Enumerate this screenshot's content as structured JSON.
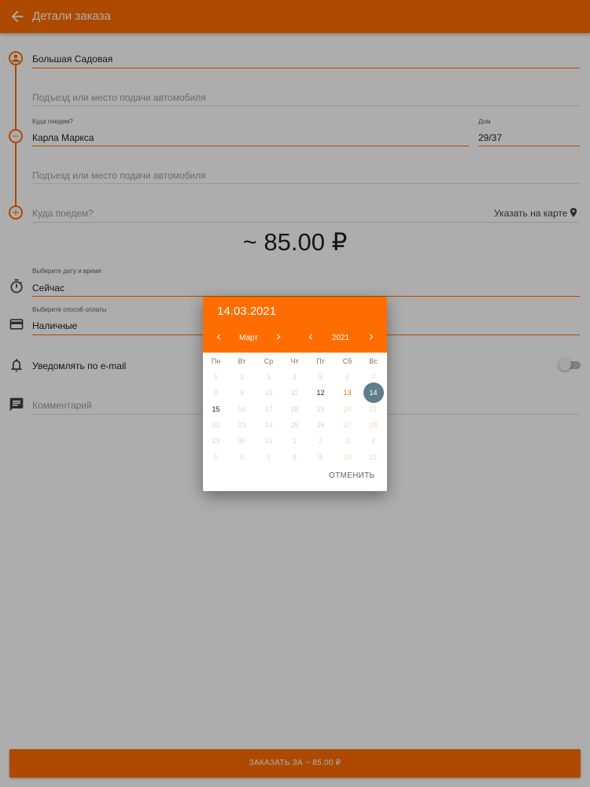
{
  "appbar": {
    "title": "Детали заказа",
    "back_icon": "arrow-back-icon"
  },
  "route": {
    "from_value": "Большая Садовая",
    "entrance_hint_1": "Подъезд или место подачи автомобиля",
    "to_label": "Куда поедем?",
    "to_value": "Карла Маркса",
    "house_label": "Дом",
    "house_value": "29/37",
    "entrance_hint_2": "Подъезд или место подачи автомобиля",
    "add_hint": "Куда поедем?",
    "map_link": "Указать на карте"
  },
  "price": "~ 85.00 ₽",
  "datetime": {
    "label": "Выберите дату и время",
    "value": "Сейчас"
  },
  "payment": {
    "label": "Выберите способ оплаты",
    "value": "Наличные"
  },
  "notify": {
    "label": "Уведомлять по e-mail",
    "enabled": false
  },
  "comment": {
    "hint": "Комментарий"
  },
  "order_button": "ЗАКАЗАТЬ ЗА ~ 85.00 ₽",
  "picker": {
    "selected_date": "14.03.2021",
    "month": "Март",
    "year": "2021",
    "weekdays": [
      "Пн",
      "Вт",
      "Ср",
      "Чт",
      "Пт",
      "Сб",
      "Вс"
    ],
    "weeks": [
      [
        "1",
        "2",
        "3",
        "4",
        "5",
        "6",
        "7"
      ],
      [
        "8",
        "9",
        "10",
        "11",
        "12",
        "13",
        "14"
      ],
      [
        "15",
        "16",
        "17",
        "18",
        "19",
        "20",
        "21"
      ],
      [
        "22",
        "23",
        "24",
        "25",
        "26",
        "27",
        "28"
      ],
      [
        "29",
        "30",
        "31",
        "1",
        "2",
        "3",
        "4"
      ],
      [
        "5",
        "6",
        "7",
        "8",
        "9",
        "10",
        "11"
      ]
    ],
    "enabled_days": [
      "12",
      "13",
      "14",
      "15"
    ],
    "selected_day": "14",
    "cancel_label": "ОТМЕНИТЬ"
  },
  "colors": {
    "accent": "#ff6d00",
    "selected": "#607d8b",
    "scrim": "rgba(0,0,0,0.32)"
  }
}
